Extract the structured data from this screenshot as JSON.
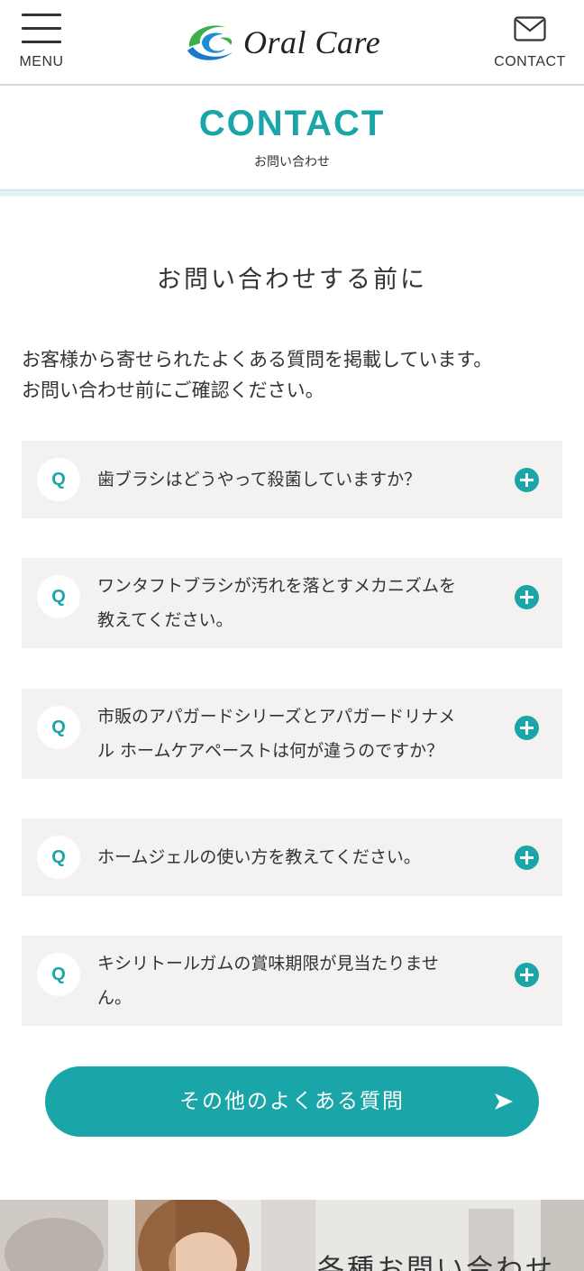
{
  "header": {
    "menu_label": "MENU",
    "logo_text": "Oral Care",
    "contact_label": "CONTACT"
  },
  "page_heading": {
    "title_en": "CONTACT",
    "title_ja": "お問い合わせ"
  },
  "section": {
    "title": "お問い合わせする前に",
    "intro_lines": [
      "お客様から寄せられたよくある質問を掲載しています。",
      "お問い合わせ前にご確認ください。"
    ]
  },
  "faq": {
    "badge": "Q",
    "items": [
      {
        "lines": [
          "歯ブラシはどうやって殺菌していますか？"
        ]
      },
      {
        "lines": [
          "ワンタフトブラシが汚れを落とすメカニズムを",
          "教えてください。"
        ]
      },
      {
        "lines": [
          "市販のアパガードシリーズとアパガードリナメ",
          "ル ホームケアペーストは何が違うのですか？"
        ]
      },
      {
        "lines": [
          "ホームジェルの使い方を教えてください。"
        ]
      },
      {
        "lines": [
          "キシリトールガムの賞味期限が見当たりませ",
          "ん。"
        ]
      }
    ]
  },
  "more_button": {
    "label": "その他のよくある質問"
  },
  "banner": {
    "text": "各種お問い合わせ"
  },
  "colors": {
    "accent": "#1aa6a8",
    "faq_bg": "#f3f2f1",
    "text": "#333333"
  }
}
